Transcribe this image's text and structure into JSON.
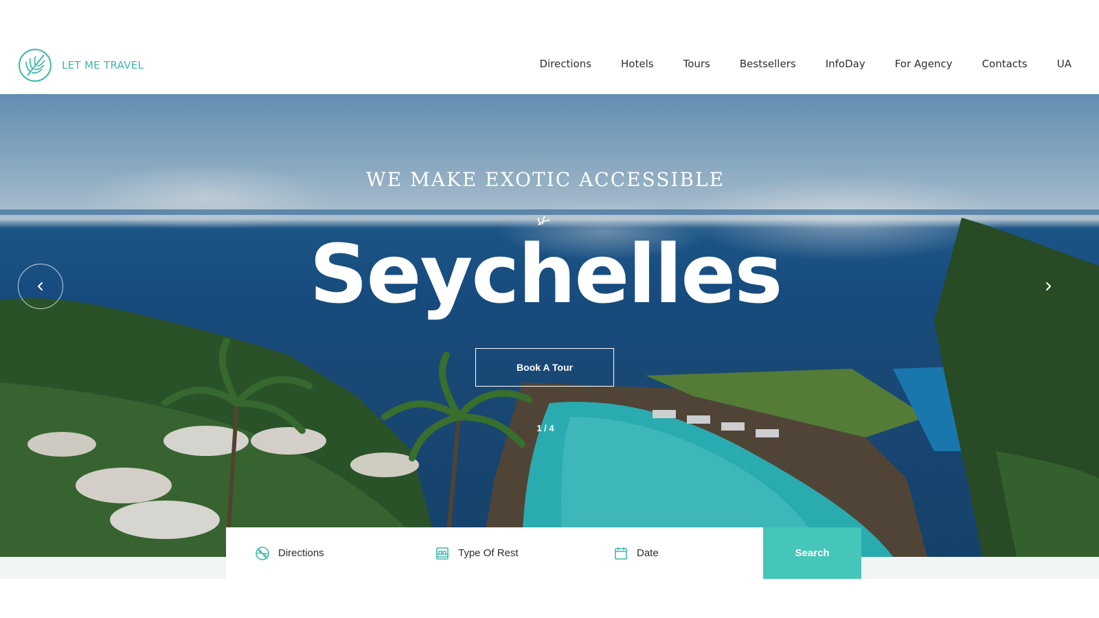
{
  "brand": {
    "name": "LET ME TRAVEL",
    "accent": "#3fb8ab",
    "logo_icon": "palm-leaf-circle-icon"
  },
  "nav": {
    "items": [
      {
        "label": "Directions"
      },
      {
        "label": "Hotels"
      },
      {
        "label": "Tours"
      },
      {
        "label": "Bestsellers"
      },
      {
        "label": "InfoDay"
      },
      {
        "label": "For Agency"
      },
      {
        "label": "Contacts"
      },
      {
        "label": "UA"
      }
    ]
  },
  "hero": {
    "tagline": "WE MAKE EXOTIC ACCESSIBLE",
    "headline": "Seychelles",
    "cta_label": "Book A Tour",
    "pager": "1 / 4",
    "prev_icon": "chevron-left-icon",
    "next_icon": "chevron-right-icon"
  },
  "search": {
    "fields": [
      {
        "label": "Directions",
        "icon": "globe-icon"
      },
      {
        "label": "Type Of Rest",
        "icon": "bed-icon"
      },
      {
        "label": "Date",
        "icon": "calendar-icon"
      }
    ],
    "button_label": "Search",
    "button_color": "#45c6b8"
  }
}
